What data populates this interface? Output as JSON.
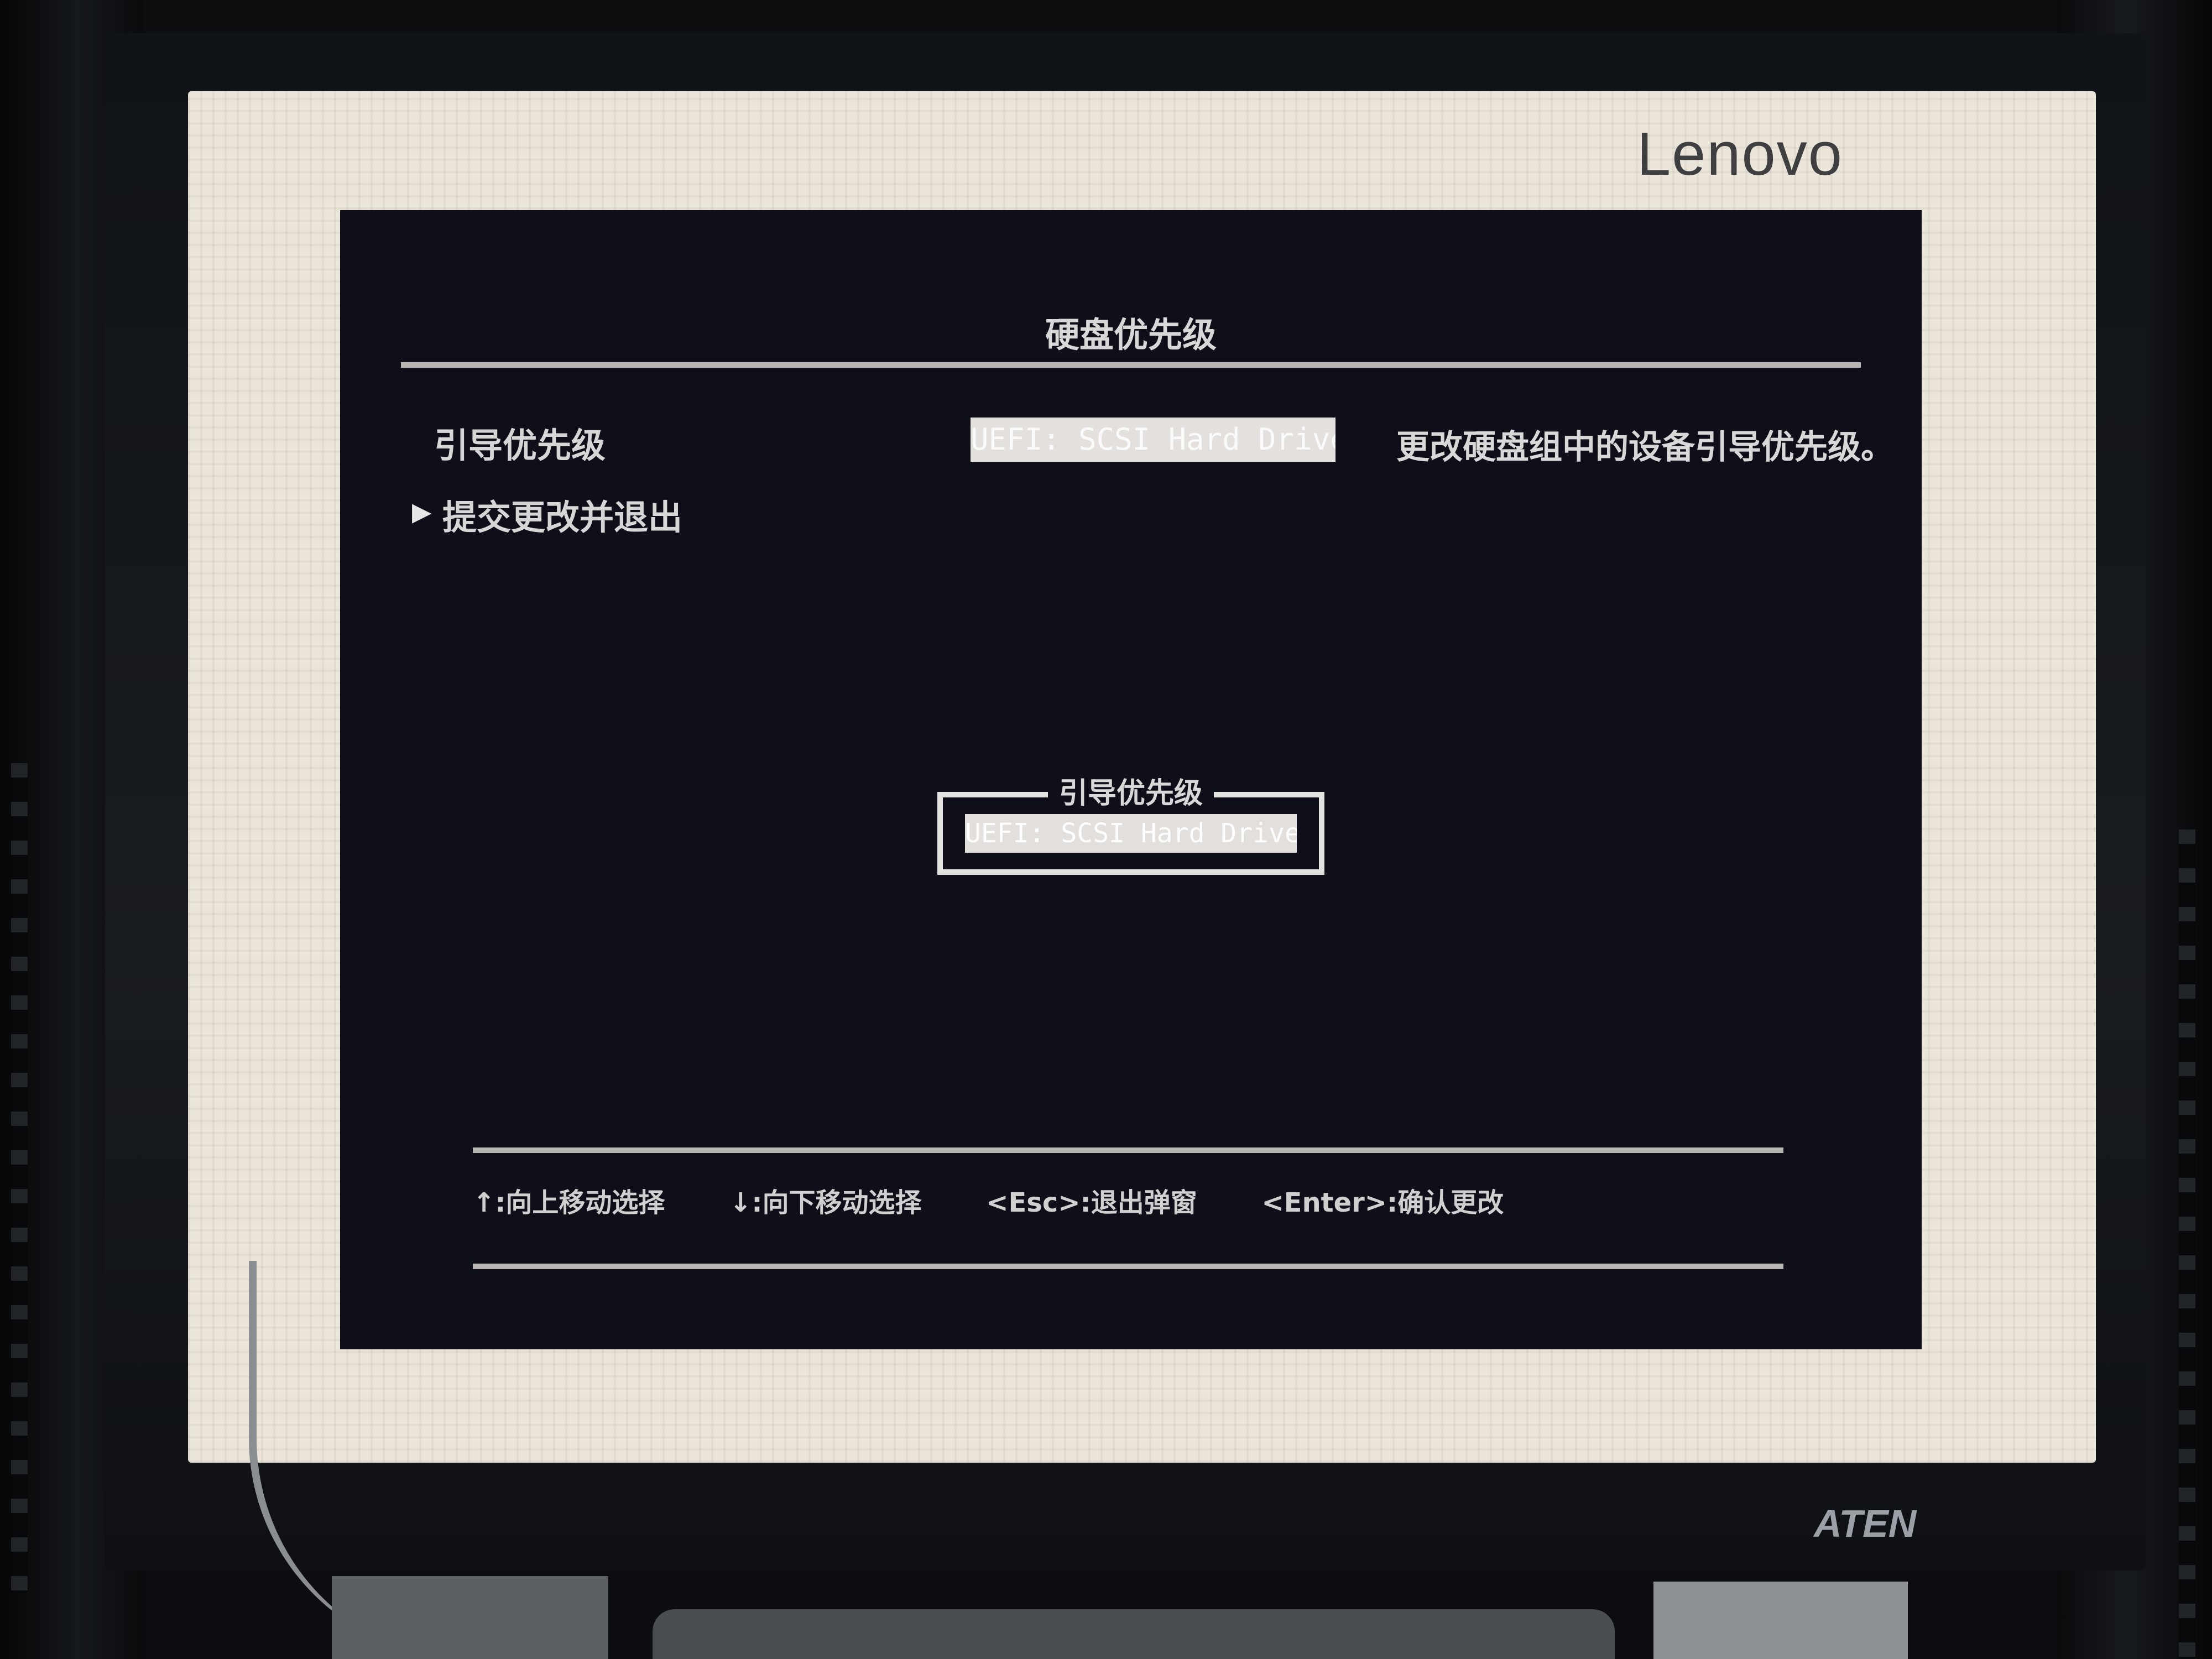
{
  "monitor": {
    "brand": "Lenovo",
    "vendor": "ATEN"
  },
  "bios": {
    "title": "硬盘优先级",
    "boot_priority_label": "引导优先级",
    "boot_priority_value": "UEFI: SCSI Hard Drive",
    "help_text": "更改硬盘组中的设备引导优先级。",
    "submit_label": "提交更改并退出",
    "popup": {
      "title": "引导优先级",
      "selected_option": "UEFI: SCSI Hard Drive"
    },
    "hints": [
      "↑:向上移动选择",
      "↓:向下移动选择",
      "<Esc>:退出弹窗",
      "<Enter>:确认更改"
    ]
  },
  "icons": {
    "selection_arrow": "triangle-right-icon"
  }
}
